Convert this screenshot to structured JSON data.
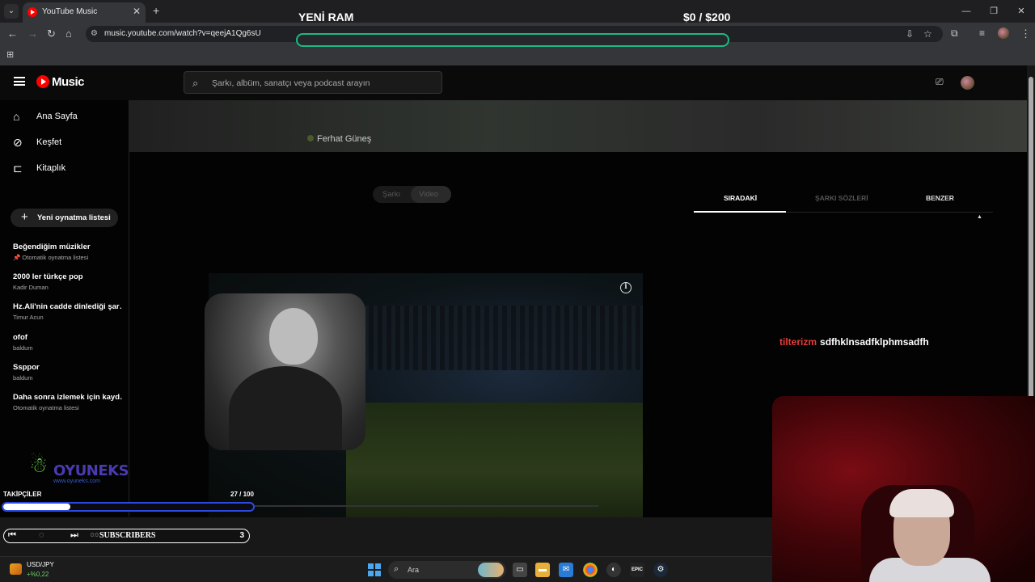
{
  "browser": {
    "tab_title": "YouTube Music",
    "tab_close": "✕",
    "new_tab": "+",
    "url": "music.youtube.com/watch?v=qeejA1Qg6sU",
    "window_controls": [
      "—",
      "❐",
      "✕"
    ]
  },
  "stream_overlay": {
    "ram_title": "YENİ RAM",
    "money": "$0 / $200",
    "ticker_red": "tilterizm",
    "ticker_white": "sdfhklnsadfklphmsadfh",
    "followers_label": "TAKİPÇİLER",
    "followers_count": "27 / 100",
    "followers_progress": 0.27,
    "subs_label": "SUBSCRIBERS",
    "subs_count": "3",
    "subs_time": "0:0",
    "watermark_brand": "OYUNEKS",
    "watermark_site": "www.oyuneks.com"
  },
  "yt": {
    "logo_text": "Music",
    "search_placeholder": "Şarkı, albüm, sanatçı veya podcast arayın",
    "nav": [
      {
        "label": "Ana Sayfa",
        "icon": "home-icon"
      },
      {
        "label": "Keşfet",
        "icon": "explore-icon"
      },
      {
        "label": "Kitaplık",
        "icon": "library-icon"
      }
    ],
    "new_playlist": "Yeni oynatma listesi",
    "playlists": [
      {
        "title": "Beğendiğim müzikler",
        "sub": "📌 Otomatik oynatma listesi"
      },
      {
        "title": "2000 ler türkçe pop",
        "sub": "Kadir Duman"
      },
      {
        "title": "Hz.Ali'nin cadde dinlediği şar…",
        "sub": "Timur Acun"
      },
      {
        "title": "ofof",
        "sub": "baldum"
      },
      {
        "title": "Ssppor",
        "sub": "baldum"
      },
      {
        "title": "Daha sonra izlemek için kayd…",
        "sub": "Otomatik oynatma listesi"
      }
    ],
    "artist": "Ferhat Güneş",
    "toggle_song": "Şarkı",
    "toggle_video": "Video",
    "right_tabs": [
      "SIRADAKİ",
      "ŞARKI SÖZLERİ",
      "BENZER"
    ],
    "active_tab": "SIRADAKİ"
  },
  "taskbar": {
    "widget_title": "USD/JPY",
    "widget_value": "+%0,22",
    "search_label": "Ara"
  },
  "colors": {
    "yt_red": "#ff0000",
    "ticker_red": "#e53b3b",
    "followers_border": "#2d4ae0",
    "accent_green": "#1db983"
  }
}
